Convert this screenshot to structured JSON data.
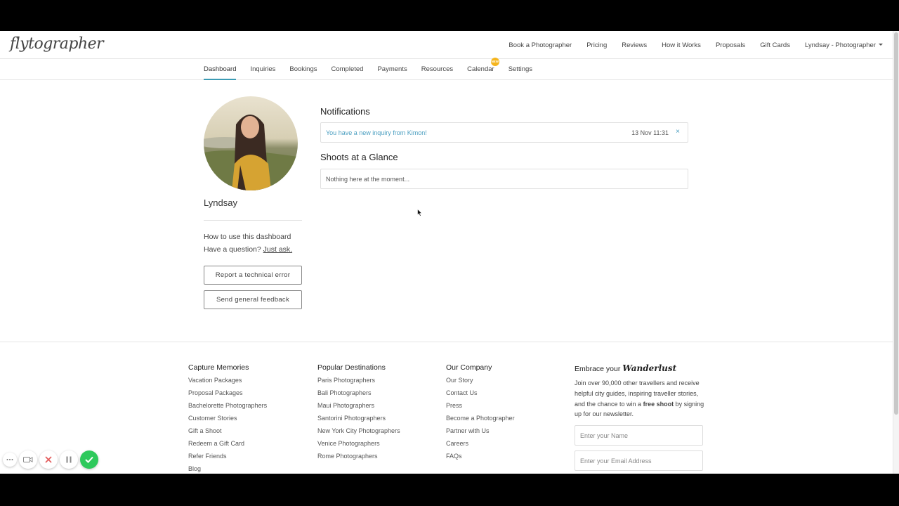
{
  "brand": {
    "logo_text": "flytographer"
  },
  "top_nav": {
    "links": [
      "Book a Photographer",
      "Pricing",
      "Reviews",
      "How it Works",
      "Proposals",
      "Gift Cards"
    ],
    "user_menu": "Lyndsay - Photographer"
  },
  "sub_nav": {
    "tabs": [
      "Dashboard",
      "Inquiries",
      "Bookings",
      "Completed",
      "Payments",
      "Resources",
      "Calendar",
      "Settings"
    ],
    "active_tab": "Dashboard",
    "calendar_badge": "NEW"
  },
  "profile": {
    "name": "Lyndsay",
    "help_line1": "How to use this dashboard",
    "help_line2_prefix": "Have a question?",
    "help_line2_link": "Just ask.",
    "report_button": "Report a technical error",
    "feedback_button": "Send general feedback"
  },
  "notifications": {
    "title": "Notifications",
    "items": [
      {
        "text": "You have a new inquiry from Kimon!",
        "time": "13 Nov 11:31",
        "close": "×"
      }
    ]
  },
  "shoots": {
    "title": "Shoots at a Glance",
    "empty_text": "Nothing here at the moment..."
  },
  "footer": {
    "columns": [
      {
        "title": "Capture Memories",
        "links": [
          "Vacation Packages",
          "Proposal Packages",
          "Bachelorette Photographers",
          "Customer Stories",
          "Gift a Shoot",
          "Redeem a Gift Card",
          "Refer Friends",
          "Blog"
        ]
      },
      {
        "title": "Popular Destinations",
        "links": [
          "Paris Photographers",
          "Bali Photographers",
          "Maui Photographers",
          "Santorini Photographers",
          "New York City Photographers",
          "Venice Photographers",
          "Rome Photographers"
        ]
      },
      {
        "title": "Our Company",
        "links": [
          "Our Story",
          "Contact Us",
          "Press",
          "Become a Photographer",
          "Partner with Us",
          "Careers",
          "FAQs"
        ]
      }
    ],
    "newsletter": {
      "title_prefix": "Embrace your",
      "title_script": "Wanderlust",
      "text_before": "Join over 90,000 other travellers and receive helpful city guides, inspiring traveller stories, and the chance to win a",
      "text_bold": "free shoot",
      "text_after": "by signing up for our newsletter.",
      "name_placeholder": "Enter your Name",
      "email_placeholder": "Enter your Email Address"
    }
  },
  "colors": {
    "accent": "#3c9bb4",
    "link_blue": "#4a9ec0",
    "badge": "#f5b51d",
    "confirm_green": "#2ec95c"
  },
  "recording_controls": {
    "icons": [
      "more-icon",
      "camera-icon",
      "close-icon",
      "pause-icon",
      "check-icon"
    ]
  }
}
